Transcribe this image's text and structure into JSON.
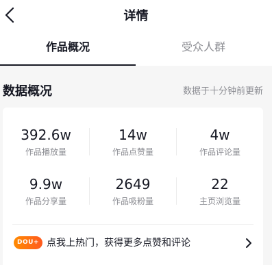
{
  "nav": {
    "title": "详情",
    "back_icon": "chevron-left-icon"
  },
  "tabs": [
    {
      "label": "作品概况",
      "active": true
    },
    {
      "label": "受众人群",
      "active": false
    }
  ],
  "section": {
    "title": "数据概况",
    "subtitle": "数据于十分钟前更新"
  },
  "metrics": [
    {
      "value": "392.6w",
      "label": "作品播放量"
    },
    {
      "value": "14w",
      "label": "作品点赞量"
    },
    {
      "value": "4w",
      "label": "作品评论量"
    },
    {
      "value": "9.9w",
      "label": "作品分享量"
    },
    {
      "value": "2649",
      "label": "作品吸粉量"
    },
    {
      "value": "22",
      "label": "主页浏览量"
    }
  ],
  "promo": {
    "badge": "DOU+",
    "text": "点我上热门，获得更多点赞和评论",
    "chevron_icon": "chevron-right-icon"
  },
  "colors": {
    "text_primary": "#161823",
    "text_secondary": "#8a8b91",
    "background": "#f6f6f6",
    "accent": "#ff6a13"
  }
}
